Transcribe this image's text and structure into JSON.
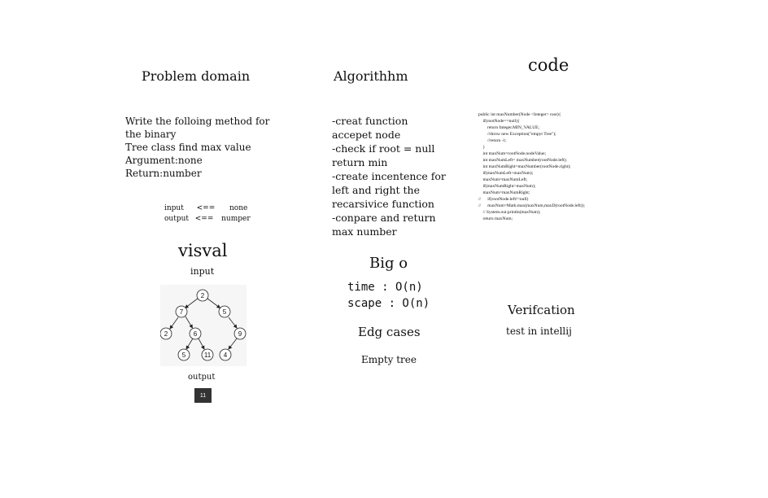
{
  "problem": {
    "title": "Problem domain",
    "lines": [
      "Write the folloing method for",
      "the binary",
      "Tree class find max value",
      "Argument:none",
      "Return:number"
    ],
    "io": {
      "input_label": "input",
      "input_arrow": "<==",
      "input_value": "none",
      "output_label": "output",
      "output_arrow": "<==",
      "output_value": "numper"
    }
  },
  "algorithm": {
    "title": "Algorithhm",
    "lines": [
      "-creat function",
      "accepet node",
      "-check if root = null",
      "return min",
      "-create incentence for",
      "left and right the",
      "recarsivice function",
      "-conpare and return",
      "max number"
    ]
  },
  "code": {
    "title": "code",
    "lines": [
      "public int maxNumber(Node <Integer> root){",
      "    if(rootNode==null){",
      "        return Integer.MIN_VALUE;",
      "        //throw new Exception(\"empyt Tree\");",
      "        //return -1;",
      "    }",
      "    int maxNum=rootNode.nodeValue;",
      "    int maxNumLeft= maxNumber(rootNode.left);",
      "    int maxNumRight=maxNumber(rootNode.right);",
      "",
      "    if(maxNumLeft>maxNum);",
      "    maxNum=maxNumLeft;",
      "    if(maxNumRight>maxNum);",
      "    maxNum=maxNumRight;",
      "",
      "//      if(rootNode.left!=null)",
      "//      maxNum=Math.max(maxNum,maxD(rootNode.left));",
      "    // System.out.println(maxNum);",
      "    return maxNum;"
    ]
  },
  "visual": {
    "title": "visval",
    "input_label": "input",
    "output_label": "output",
    "output_value": "11",
    "tree_nodes": [
      "2",
      "7",
      "5",
      "2",
      "6",
      "9",
      "5",
      "11",
      "4"
    ]
  },
  "bigo": {
    "title": "Big o",
    "time": "time : O(n)",
    "space": "scape : O(n)"
  },
  "edge": {
    "title": "Edg cases",
    "text": "Empty tree"
  },
  "verification": {
    "title": "Verifcation",
    "text": "test in intellij"
  }
}
